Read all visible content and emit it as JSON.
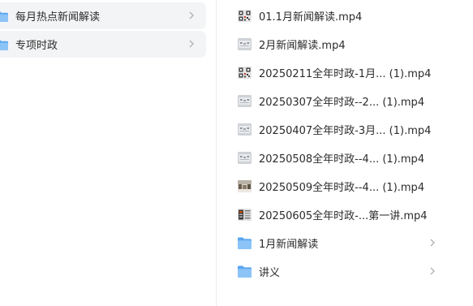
{
  "left_folders": [
    {
      "label": "每月热点新闻解读"
    },
    {
      "label": "专项时政"
    }
  ],
  "right_items": [
    {
      "name": "01.1月新闻解读.mp4",
      "icon": "video-thumbnail-icon",
      "thumb_style": "qr"
    },
    {
      "name": "2月新闻解读.mp4",
      "icon": "video-thumbnail-icon",
      "thumb_style": "grey"
    },
    {
      "name": "20250211全年时政-1月...  (1).mp4",
      "icon": "video-thumbnail-icon",
      "thumb_style": "qr"
    },
    {
      "name": "20250307全年时政--2...  (1).mp4",
      "icon": "video-thumbnail-icon",
      "thumb_style": "grey"
    },
    {
      "name": "20250407全年时政-3月...  (1).mp4",
      "icon": "video-thumbnail-icon",
      "thumb_style": "grey"
    },
    {
      "name": "20250508全年时政--4...  (1).mp4",
      "icon": "video-thumbnail-icon",
      "thumb_style": "grey"
    },
    {
      "name": "20250509全年时政--4...  (1).mp4",
      "icon": "video-thumbnail-icon",
      "thumb_style": "photo"
    },
    {
      "name": "20250605全年时政-...第一讲.mp4",
      "icon": "video-thumbnail-icon",
      "thumb_style": "dark"
    },
    {
      "name": "1月新闻解读",
      "icon": "folder-icon",
      "thumb_style": "folder"
    },
    {
      "name": "讲义",
      "icon": "folder-icon",
      "thumb_style": "folder"
    }
  ],
  "colors": {
    "folder_blue": "#5aa6f0",
    "folder_blue_light": "#8cc4f8",
    "row_highlight": "#f3f4f6",
    "chevron": "#b0b3b8"
  }
}
